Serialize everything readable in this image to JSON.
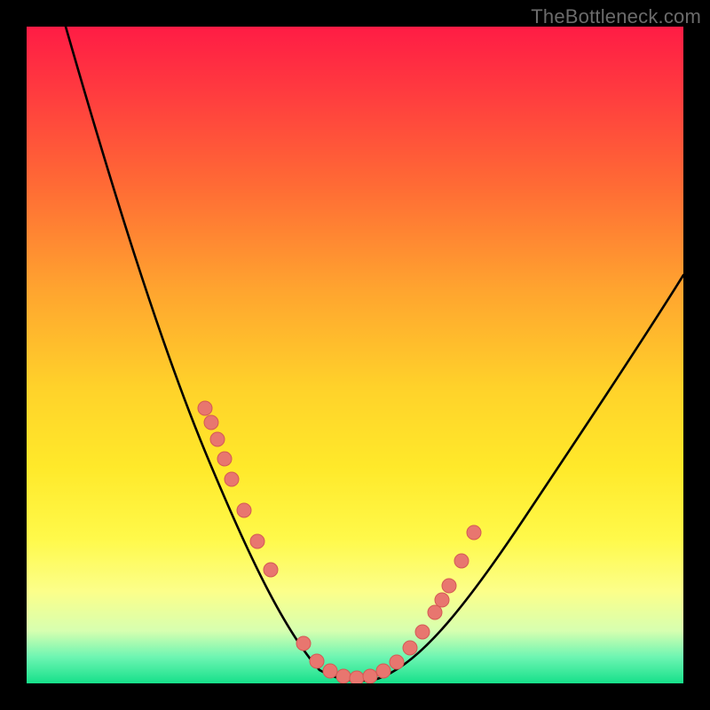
{
  "watermark": {
    "text": "TheBottleneck.com"
  },
  "colors": {
    "frame": "#000000",
    "curve": "#000000",
    "marker_fill": "#e8766f",
    "marker_stroke": "#d45a55"
  },
  "chart_data": {
    "type": "line",
    "title": "",
    "xlabel": "",
    "ylabel": "",
    "xlim": [
      0,
      100
    ],
    "ylim": [
      0,
      100
    ],
    "grid": false,
    "legend": false,
    "series": [
      {
        "name": "bottleneck-curve",
        "x": [
          6,
          10,
          14,
          18,
          22,
          25,
          28,
          31,
          34,
          37,
          39,
          41,
          43,
          45,
          47,
          50,
          53,
          56,
          60,
          65,
          72,
          80,
          90,
          100
        ],
        "y": [
          100,
          90,
          79,
          68,
          57,
          48,
          40,
          32,
          25,
          18,
          13,
          9,
          6,
          3,
          1,
          0,
          1,
          3,
          7,
          13,
          22,
          33,
          48,
          63
        ]
      }
    ],
    "markers": {
      "left_cluster": {
        "x": [
          27,
          28,
          29,
          30,
          31,
          33,
          35,
          37
        ],
        "y": [
          42,
          40,
          37,
          34,
          31,
          26,
          21,
          17
        ]
      },
      "bottom_cluster": {
        "x": [
          42,
          44,
          46,
          48,
          50,
          52,
          54,
          56
        ],
        "y": [
          6,
          3,
          2,
          1,
          0,
          1,
          2,
          3
        ]
      },
      "right_cluster": {
        "x": [
          58,
          60,
          62,
          63,
          64,
          66,
          68
        ],
        "y": [
          6,
          8,
          11,
          13,
          15,
          20,
          25
        ]
      }
    }
  }
}
